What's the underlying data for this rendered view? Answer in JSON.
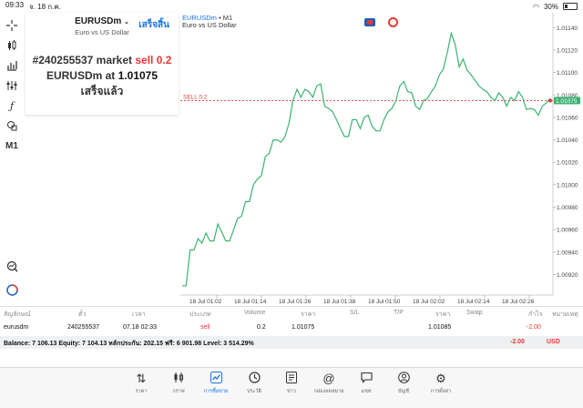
{
  "status_bar": {
    "time": "09:33",
    "date": "จ. 18 ก.ค.",
    "battery": "30%"
  },
  "toolbar": {
    "icons": [
      "crosshair-icon",
      "candles-icon",
      "bars-icon",
      "indicators-icon",
      "function-icon",
      "shapes-icon"
    ],
    "timeframe": "M1"
  },
  "order_panel": {
    "symbol": "EURUSDm",
    "description": "Euro vs US Dollar",
    "done_label": "เสร็จสิ้น",
    "order_number": "#240255537",
    "order_type": "market",
    "side_volume": "sell 0.2",
    "symbol_at": "EURUSDm at",
    "price": "1.01075",
    "status": "เสร็จแล้ว"
  },
  "chart": {
    "symbol": "EURUSDm",
    "timeframe_label": "• M1",
    "description": "Euro vs US Dollar",
    "sell_line_label": "SELL 0.2",
    "current_price_label": "1.01075"
  },
  "chart_data": {
    "type": "line",
    "y_ticks": [
      "1.01140",
      "1.01120",
      "1.01100",
      "1.01080",
      "1.01060",
      "1.01040",
      "1.01020",
      "1.01000",
      "1.00980",
      "1.00960",
      "1.00940",
      "1.00920"
    ],
    "x_ticks": [
      "18 Jul 01:02",
      "18 Jul 01:14",
      "18 Jul 01:26",
      "18 Jul 01:38",
      "18 Jul 01:50",
      "18 Jul 02:02",
      "18 Jul 02:14",
      "18 Jul 02:26"
    ],
    "ylim": [
      1.00905,
      1.0115
    ],
    "sell_level": 1.01075,
    "series": [
      {
        "values": [
          1.0091,
          1.0091,
          1.00942,
          1.00942,
          1.00952,
          1.00948,
          1.00957,
          1.0095,
          1.0095,
          1.00965,
          1.00958,
          1.0095,
          1.0095,
          1.0096,
          1.0097,
          1.00972,
          1.00985,
          1.00985,
          1.01,
          1.01005,
          1.01008,
          1.01025,
          1.01028,
          1.0104,
          1.0104,
          1.01038,
          1.01043,
          1.01055,
          1.01075,
          1.01085,
          1.01078,
          1.01085,
          1.01083,
          1.01078,
          1.01088,
          1.0109,
          1.0107,
          1.01068,
          1.01065,
          1.01058,
          1.0105,
          1.01043,
          1.01043,
          1.01058,
          1.01058,
          1.0105,
          1.0106,
          1.01062,
          1.01052,
          1.01048,
          1.01048,
          1.01058,
          1.01065,
          1.01068,
          1.01075,
          1.01088,
          1.01092,
          1.01083,
          1.01082,
          1.0107,
          1.01067,
          1.01075,
          1.01077,
          1.01083,
          1.01088,
          1.01098,
          1.01103,
          1.01118,
          1.01135,
          1.01125,
          1.01105,
          1.01112,
          1.01102,
          1.01098,
          1.01093,
          1.01088,
          1.01085,
          1.01083,
          1.01078,
          1.01075,
          1.01082,
          1.01078,
          1.0107,
          1.01078,
          1.01075,
          1.01083,
          1.01078,
          1.01067,
          1.01068,
          1.01067,
          1.01062,
          1.0107,
          1.01073,
          1.01077
        ]
      }
    ]
  },
  "positions": {
    "headers": [
      "สัญลักษณ์",
      "ตั๋ว",
      "เวลา",
      "ประเภท",
      "Volume",
      "ราคา",
      "S/L",
      "T/P",
      "ราคา",
      "Swap",
      "กำไร",
      "หมายเหตุ"
    ],
    "row": {
      "symbol": "eurusdm",
      "ticket": "240255537",
      "time": "07.18 02:33",
      "type": "sell",
      "volume": "0.2",
      "price": "1.01075",
      "sl": "",
      "tp": "",
      "current_price": "1.01085",
      "swap": "",
      "profit": "-2.00",
      "comment": ""
    }
  },
  "balance": {
    "text": "Balance: 7 106.13 Equity: 7 104.13 หลักประกัน: 202.15 ฟรี: 6 901.98 Level: 3 514.29%",
    "profit": "-2.00",
    "currency": "USD"
  },
  "nav": [
    {
      "name": "quotes",
      "icon": "quotes-icon",
      "label": "ราคา"
    },
    {
      "name": "chart",
      "icon": "chart-icon",
      "label": "กราฟ"
    },
    {
      "name": "trade",
      "icon": "trade-icon",
      "label": "การซื้อขาย"
    },
    {
      "name": "history",
      "icon": "history-icon",
      "label": "ประวัติ"
    },
    {
      "name": "news",
      "icon": "news-icon",
      "label": "ข่าว"
    },
    {
      "name": "mailbox",
      "icon": "mailbox-icon",
      "label": "กล่องจดหมาย"
    },
    {
      "name": "chat",
      "icon": "chat-icon",
      "label": "แชท"
    },
    {
      "name": "accounts",
      "icon": "accounts-icon",
      "label": "บัญชี"
    },
    {
      "name": "settings",
      "icon": "settings-icon",
      "label": "การตั้งค่า"
    }
  ],
  "colors": {
    "line": "#3cb371",
    "sell": "#e53935",
    "accent": "#1a73e8"
  }
}
